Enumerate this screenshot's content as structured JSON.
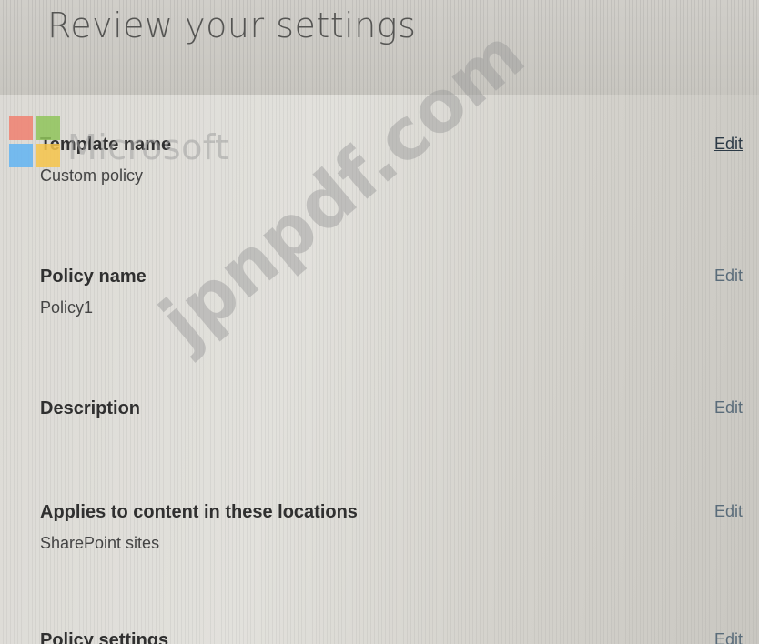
{
  "page": {
    "title": "Review your settings"
  },
  "watermark": {
    "brand_text": "Microsoft",
    "site_text": "jpnpdf.com"
  },
  "sections": [
    {
      "label": "Template name",
      "value": "Custom policy",
      "edit_label": "Edit"
    },
    {
      "label": "Policy name",
      "value": "Policy1",
      "edit_label": "Edit"
    },
    {
      "label": "Description",
      "value": "",
      "edit_label": "Edit"
    },
    {
      "label": "Applies to content in these locations",
      "value": "SharePoint sites",
      "edit_label": "Edit"
    },
    {
      "label": "Policy settings",
      "value": "",
      "edit_label": "Edit"
    }
  ]
}
